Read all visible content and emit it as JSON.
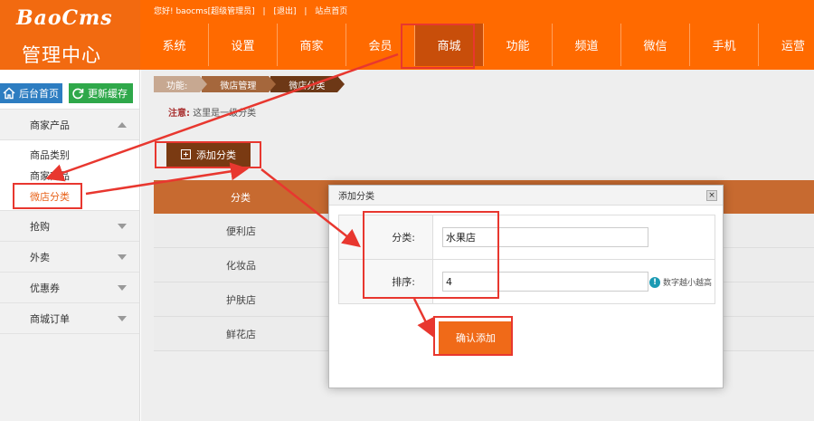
{
  "header": {
    "brand": "BaoCms",
    "title": "管理中心",
    "greeting": "您好! baocms[超级管理员]",
    "logout": "[退出]",
    "site_home": "站点首页",
    "sep": "|",
    "nav": [
      "系统",
      "设置",
      "商家",
      "会员",
      "商城",
      "功能",
      "频道",
      "微信",
      "手机",
      "运营"
    ],
    "active_nav": "商城"
  },
  "sidebar": {
    "home_btn": "后台首页",
    "refresh_btn": "更新缓存",
    "groups": [
      {
        "label": "商家产品",
        "items": [
          "商品类别",
          "商家商品",
          "微店分类"
        ]
      },
      {
        "label": "抢购"
      },
      {
        "label": "外卖"
      },
      {
        "label": "优惠券"
      },
      {
        "label": "商城订单"
      }
    ],
    "active_item": "微店分类"
  },
  "main": {
    "breadcrumb": [
      "功能:",
      "微店管理",
      "微店分类"
    ],
    "notice_label": "注意:",
    "notice_text": "这里是一级分类",
    "add_button": "添加分类",
    "table_header": "分类",
    "rows": [
      "便利店",
      "化妆品",
      "护肤店",
      "鲜花店"
    ]
  },
  "dialog": {
    "title": "添加分类",
    "close": "×",
    "category_label": "分类:",
    "category_value": "水果店",
    "order_label": "排序:",
    "order_value": "4",
    "hint": "数字越小越高",
    "confirm": "确认添加"
  },
  "colors": {
    "header": "#ff6a00",
    "active_nav": "#c84e0a",
    "annotation": "#e8372f",
    "confirm": "#f06a18"
  }
}
